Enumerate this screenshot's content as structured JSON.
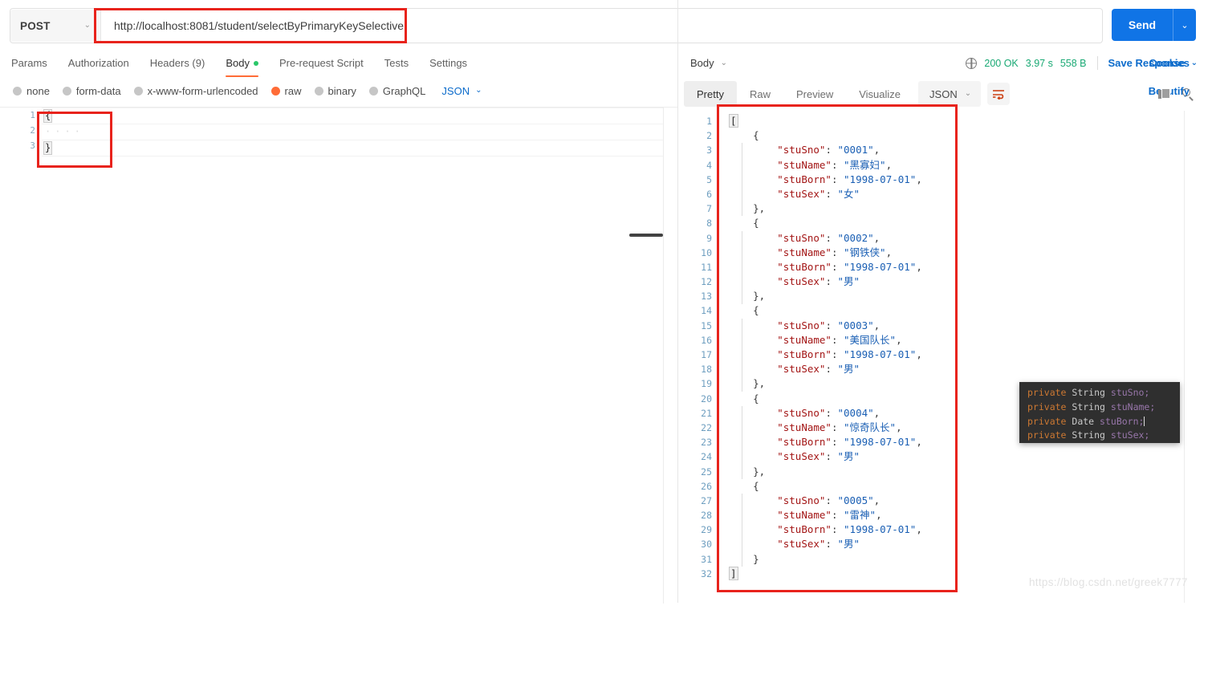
{
  "request": {
    "method": "POST",
    "method_caret": "⌄",
    "url": "http://localhost:8081/student/selectByPrimaryKeySelective",
    "send_label": "Send",
    "send_caret": "⌄",
    "tabs": [
      {
        "label": "Params",
        "active": false
      },
      {
        "label": "Authorization",
        "active": false
      },
      {
        "label": "Headers (9)",
        "active": false
      },
      {
        "label": "Body",
        "active": true,
        "dot": true
      },
      {
        "label": "Pre-request Script",
        "active": false
      },
      {
        "label": "Tests",
        "active": false
      },
      {
        "label": "Settings",
        "active": false
      }
    ],
    "cookies_label": "Cookies",
    "body_types": [
      {
        "label": "none",
        "selected": false
      },
      {
        "label": "form-data",
        "selected": false
      },
      {
        "label": "x-www-form-urlencoded",
        "selected": false
      },
      {
        "label": "raw",
        "selected": true
      },
      {
        "label": "binary",
        "selected": false
      },
      {
        "label": "GraphQL",
        "selected": false
      }
    ],
    "raw_format": "JSON",
    "raw_format_caret": "⌄",
    "beautify_label": "Beautify",
    "editor": {
      "line_numbers": [
        "1",
        "2",
        "3"
      ],
      "lines": [
        {
          "text": "{",
          "type": "brace"
        },
        {
          "text": "····",
          "type": "dots"
        },
        {
          "text": "}",
          "type": "brace"
        }
      ]
    }
  },
  "response": {
    "body_selector": "Body",
    "body_selector_caret": "⌄",
    "status": "200 OK",
    "time": "3.97 s",
    "size": "558 B",
    "save_label": "Save Response",
    "save_caret": "⌄",
    "tabs": [
      {
        "label": "Pretty",
        "active": true
      },
      {
        "label": "Raw",
        "active": false
      },
      {
        "label": "Preview",
        "active": false
      },
      {
        "label": "Visualize",
        "active": false
      }
    ],
    "format": "JSON",
    "format_caret": "⌄",
    "line_numbers": [
      "1",
      "2",
      "3",
      "4",
      "5",
      "6",
      "7",
      "8",
      "9",
      "10",
      "11",
      "12",
      "13",
      "14",
      "15",
      "16",
      "17",
      "18",
      "19",
      "20",
      "21",
      "22",
      "23",
      "24",
      "25",
      "26",
      "27",
      "28",
      "29",
      "30",
      "31",
      "32"
    ],
    "json_lines": [
      {
        "indent": 0,
        "parts": [
          {
            "t": "[",
            "c": "bracket-hl"
          }
        ]
      },
      {
        "indent": 1,
        "parts": [
          {
            "t": "{",
            "c": "p"
          }
        ]
      },
      {
        "indent": 2,
        "parts": [
          {
            "t": "\"stuSno\"",
            "c": "k"
          },
          {
            "t": ": ",
            "c": "p"
          },
          {
            "t": "\"0001\"",
            "c": "s"
          },
          {
            "t": ",",
            "c": "p"
          }
        ]
      },
      {
        "indent": 2,
        "parts": [
          {
            "t": "\"stuName\"",
            "c": "k"
          },
          {
            "t": ": ",
            "c": "p"
          },
          {
            "t": "\"黑寡妇\"",
            "c": "s"
          },
          {
            "t": ",",
            "c": "p"
          }
        ]
      },
      {
        "indent": 2,
        "parts": [
          {
            "t": "\"stuBorn\"",
            "c": "k"
          },
          {
            "t": ": ",
            "c": "p"
          },
          {
            "t": "\"1998-07-01\"",
            "c": "s"
          },
          {
            "t": ",",
            "c": "p"
          }
        ]
      },
      {
        "indent": 2,
        "parts": [
          {
            "t": "\"stuSex\"",
            "c": "k"
          },
          {
            "t": ": ",
            "c": "p"
          },
          {
            "t": "\"女\"",
            "c": "s"
          }
        ]
      },
      {
        "indent": 1,
        "parts": [
          {
            "t": "},",
            "c": "p"
          }
        ]
      },
      {
        "indent": 1,
        "parts": [
          {
            "t": "{",
            "c": "p"
          }
        ]
      },
      {
        "indent": 2,
        "parts": [
          {
            "t": "\"stuSno\"",
            "c": "k"
          },
          {
            "t": ": ",
            "c": "p"
          },
          {
            "t": "\"0002\"",
            "c": "s"
          },
          {
            "t": ",",
            "c": "p"
          }
        ]
      },
      {
        "indent": 2,
        "parts": [
          {
            "t": "\"stuName\"",
            "c": "k"
          },
          {
            "t": ": ",
            "c": "p"
          },
          {
            "t": "\"钢铁侠\"",
            "c": "s"
          },
          {
            "t": ",",
            "c": "p"
          }
        ]
      },
      {
        "indent": 2,
        "parts": [
          {
            "t": "\"stuBorn\"",
            "c": "k"
          },
          {
            "t": ": ",
            "c": "p"
          },
          {
            "t": "\"1998-07-01\"",
            "c": "s"
          },
          {
            "t": ",",
            "c": "p"
          }
        ]
      },
      {
        "indent": 2,
        "parts": [
          {
            "t": "\"stuSex\"",
            "c": "k"
          },
          {
            "t": ": ",
            "c": "p"
          },
          {
            "t": "\"男\"",
            "c": "s"
          }
        ]
      },
      {
        "indent": 1,
        "parts": [
          {
            "t": "},",
            "c": "p"
          }
        ]
      },
      {
        "indent": 1,
        "parts": [
          {
            "t": "{",
            "c": "p"
          }
        ]
      },
      {
        "indent": 2,
        "parts": [
          {
            "t": "\"stuSno\"",
            "c": "k"
          },
          {
            "t": ": ",
            "c": "p"
          },
          {
            "t": "\"0003\"",
            "c": "s"
          },
          {
            "t": ",",
            "c": "p"
          }
        ]
      },
      {
        "indent": 2,
        "parts": [
          {
            "t": "\"stuName\"",
            "c": "k"
          },
          {
            "t": ": ",
            "c": "p"
          },
          {
            "t": "\"美国队长\"",
            "c": "s"
          },
          {
            "t": ",",
            "c": "p"
          }
        ]
      },
      {
        "indent": 2,
        "parts": [
          {
            "t": "\"stuBorn\"",
            "c": "k"
          },
          {
            "t": ": ",
            "c": "p"
          },
          {
            "t": "\"1998-07-01\"",
            "c": "s"
          },
          {
            "t": ",",
            "c": "p"
          }
        ]
      },
      {
        "indent": 2,
        "parts": [
          {
            "t": "\"stuSex\"",
            "c": "k"
          },
          {
            "t": ": ",
            "c": "p"
          },
          {
            "t": "\"男\"",
            "c": "s"
          }
        ]
      },
      {
        "indent": 1,
        "parts": [
          {
            "t": "},",
            "c": "p"
          }
        ]
      },
      {
        "indent": 1,
        "parts": [
          {
            "t": "{",
            "c": "p"
          }
        ]
      },
      {
        "indent": 2,
        "parts": [
          {
            "t": "\"stuSno\"",
            "c": "k"
          },
          {
            "t": ": ",
            "c": "p"
          },
          {
            "t": "\"0004\"",
            "c": "s"
          },
          {
            "t": ",",
            "c": "p"
          }
        ]
      },
      {
        "indent": 2,
        "parts": [
          {
            "t": "\"stuName\"",
            "c": "k"
          },
          {
            "t": ": ",
            "c": "p"
          },
          {
            "t": "\"惊奇队长\"",
            "c": "s"
          },
          {
            "t": ",",
            "c": "p"
          }
        ]
      },
      {
        "indent": 2,
        "parts": [
          {
            "t": "\"stuBorn\"",
            "c": "k"
          },
          {
            "t": ": ",
            "c": "p"
          },
          {
            "t": "\"1998-07-01\"",
            "c": "s"
          },
          {
            "t": ",",
            "c": "p"
          }
        ]
      },
      {
        "indent": 2,
        "parts": [
          {
            "t": "\"stuSex\"",
            "c": "k"
          },
          {
            "t": ": ",
            "c": "p"
          },
          {
            "t": "\"男\"",
            "c": "s"
          }
        ]
      },
      {
        "indent": 1,
        "parts": [
          {
            "t": "},",
            "c": "p"
          }
        ]
      },
      {
        "indent": 1,
        "parts": [
          {
            "t": "{",
            "c": "p"
          }
        ]
      },
      {
        "indent": 2,
        "parts": [
          {
            "t": "\"stuSno\"",
            "c": "k"
          },
          {
            "t": ": ",
            "c": "p"
          },
          {
            "t": "\"0005\"",
            "c": "s"
          },
          {
            "t": ",",
            "c": "p"
          }
        ]
      },
      {
        "indent": 2,
        "parts": [
          {
            "t": "\"stuName\"",
            "c": "k"
          },
          {
            "t": ": ",
            "c": "p"
          },
          {
            "t": "\"雷神\"",
            "c": "s"
          },
          {
            "t": ",",
            "c": "p"
          }
        ]
      },
      {
        "indent": 2,
        "parts": [
          {
            "t": "\"stuBorn\"",
            "c": "k"
          },
          {
            "t": ": ",
            "c": "p"
          },
          {
            "t": "\"1998-07-01\"",
            "c": "s"
          },
          {
            "t": ",",
            "c": "p"
          }
        ]
      },
      {
        "indent": 2,
        "parts": [
          {
            "t": "\"stuSex\"",
            "c": "k"
          },
          {
            "t": ": ",
            "c": "p"
          },
          {
            "t": "\"男\"",
            "c": "s"
          }
        ]
      },
      {
        "indent": 1,
        "parts": [
          {
            "t": "}",
            "c": "p"
          }
        ]
      },
      {
        "indent": 0,
        "parts": [
          {
            "t": "]",
            "c": "bracket-hl"
          }
        ]
      }
    ]
  },
  "code_overlay": {
    "lines": [
      {
        "kw": "private",
        "type": "String",
        "name": "stuSno;"
      },
      {
        "kw": "private",
        "type": "String",
        "name": "stuName;"
      },
      {
        "kw": "private",
        "type": "Date",
        "name": "stuBorn;"
      },
      {
        "kw": "private",
        "type": "String",
        "name": "stuSex;"
      }
    ]
  },
  "watermark": "https://blog.csdn.net/greek7777",
  "colors": {
    "accent_orange": "#ff6c37",
    "link_blue": "#0b6bcb",
    "send_blue": "#1074e6",
    "status_green": "#19a974",
    "annotation_red": "#e8231c"
  }
}
